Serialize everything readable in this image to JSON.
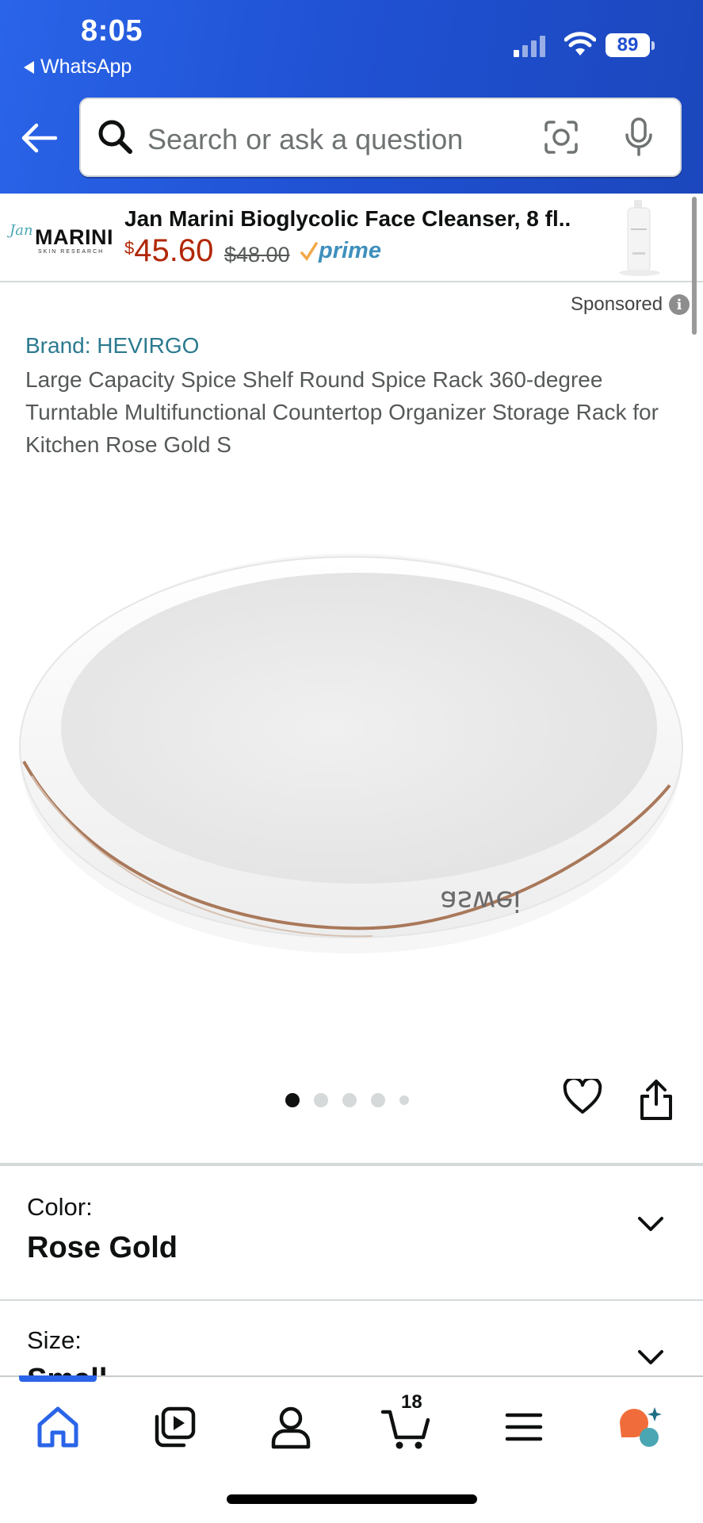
{
  "status_bar": {
    "time": "8:05",
    "back_app": "WhatsApp",
    "battery": "89"
  },
  "search": {
    "placeholder": "Search or ask a question"
  },
  "ad": {
    "brand_logo_text": "MARINI",
    "brand_logo_script": "Jan",
    "brand_logo_sub": "SKIN RESEARCH",
    "title": "Jan Marini Bioglycolic Face Cleanser, 8 fl..",
    "currency": "$",
    "price": "45.60",
    "was_price": "$48.00",
    "prime_label": "prime"
  },
  "sponsored": {
    "label": "Sponsored",
    "info_glyph": "i"
  },
  "product": {
    "brand": "Brand: HEVIRGO",
    "title": "Large Capacity Spice Shelf Round Spice Rack 360-degree Turntable Multifunctional Countertop Organizer Storage Rack for Kitchen Rose Gold S",
    "image_logo_text": "aswei",
    "image_count": 5,
    "active_image_index": 0
  },
  "options": {
    "color_label": "Color:",
    "color_value": "Rose Gold",
    "size_label": "Size:",
    "size_value": "Small"
  },
  "bottom_nav": {
    "items": [
      {
        "name": "home-icon",
        "active": true
      },
      {
        "name": "video-icon"
      },
      {
        "name": "account-icon"
      },
      {
        "name": "cart-icon"
      },
      {
        "name": "menu-icon"
      },
      {
        "name": "rufus-ai-icon"
      }
    ],
    "cart_count": "18"
  },
  "colors": {
    "header_blue": "#2052d4",
    "price_red": "#b12704",
    "brand_link": "#2b7a8f",
    "prime_blue": "#3f8fbd",
    "prime_check": "#f3a847",
    "nav_active": "#2a64e8"
  }
}
